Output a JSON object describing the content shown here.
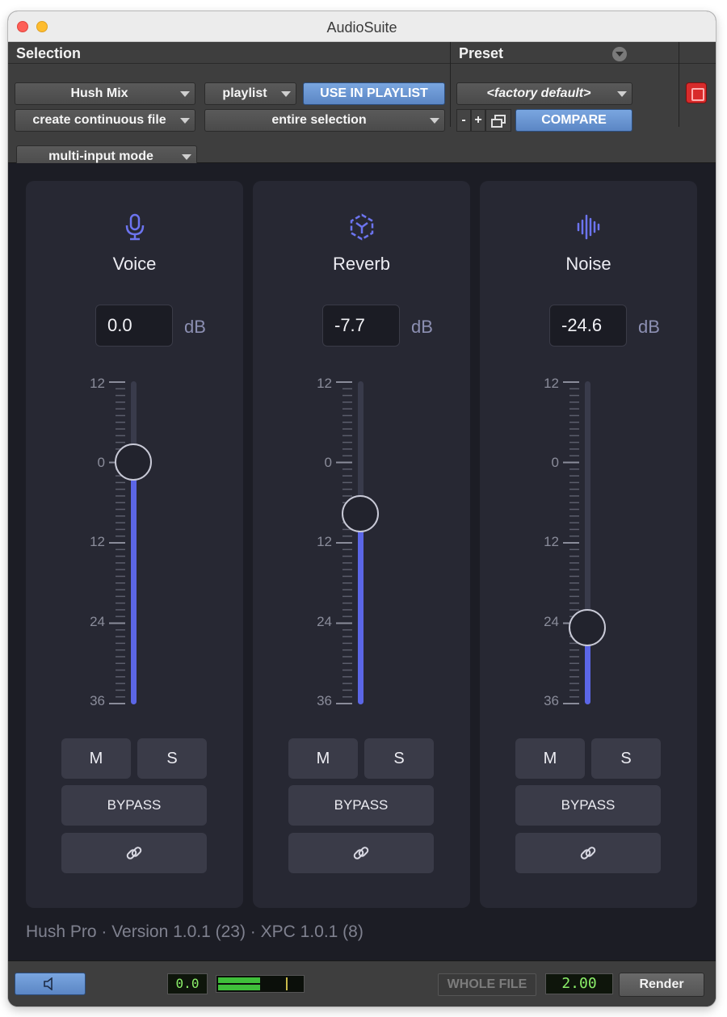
{
  "window": {
    "title": "AudioSuite"
  },
  "header": {
    "selection_label": "Selection",
    "preset_label": "Preset",
    "plugin_dropdown": "Hush Mix",
    "target_dropdown": "playlist",
    "use_in_playlist": "USE IN PLAYLIST",
    "file_mode_dropdown": "create continuous file",
    "selection_mode_dropdown": "entire selection",
    "input_mode_dropdown": "multi-input mode",
    "preset_dropdown": "<factory default>",
    "preset_minus": "-",
    "preset_plus": "+",
    "compare": "COMPARE"
  },
  "scale_labels": [
    "12",
    "0",
    "12",
    "24",
    "36"
  ],
  "channels": [
    {
      "name": "Voice",
      "icon": "microphone-icon",
      "value_db": 0.0,
      "value_text": "0.0",
      "unit": "dB",
      "mute": "M",
      "solo": "S",
      "bypass": "BYPASS"
    },
    {
      "name": "Reverb",
      "icon": "reverb-icon",
      "value_db": -7.7,
      "value_text": "-7.7",
      "unit": "dB",
      "mute": "M",
      "solo": "S",
      "bypass": "BYPASS"
    },
    {
      "name": "Noise",
      "icon": "noise-waveform-icon",
      "value_db": -24.6,
      "value_text": "-24.6",
      "unit": "dB",
      "mute": "M",
      "solo": "S",
      "bypass": "BYPASS"
    }
  ],
  "fader_range_db": [
    12,
    -36
  ],
  "version_text": "Hush Pro · Version 1.0.1 (23) · XPC 1.0.1 (8)",
  "footer": {
    "level_readout": "0.0",
    "whole_file": "WHOLE FILE",
    "handle_value": "2.00",
    "render": "Render"
  },
  "colors": {
    "accent": "#5b66e6",
    "panel_bg": "#272833",
    "lcd_text": "#8cf06a"
  }
}
